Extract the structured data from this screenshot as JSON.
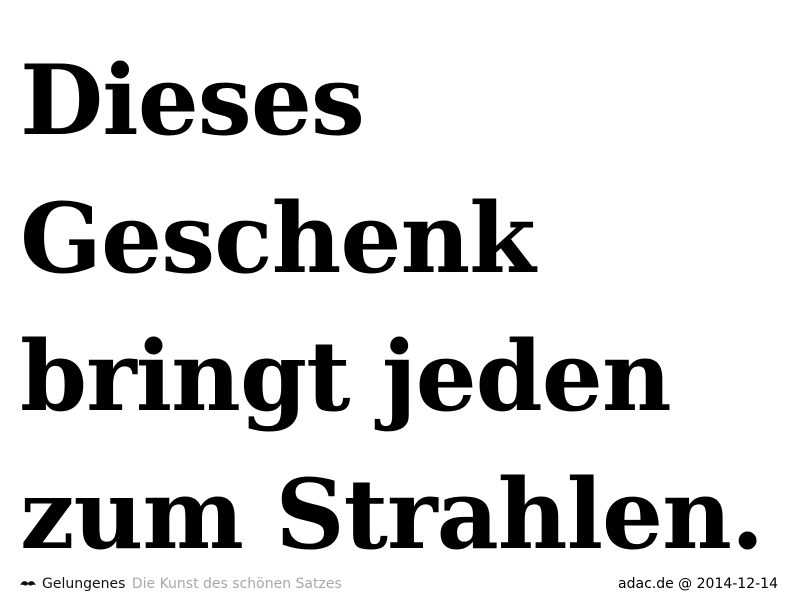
{
  "headline": {
    "lines": [
      "Dieses",
      "Geschenk",
      "bringt jeden",
      "zum Strahlen."
    ]
  },
  "footer": {
    "logo_icon": "mustache-icon",
    "brand": "Gelungenes",
    "tagline": "Die Kunst des schönen Satzes",
    "source": "adac.de @ 2014-12-14"
  },
  "colors": {
    "text": "#000000",
    "muted": "#a8a8a8",
    "background": "#ffffff"
  }
}
